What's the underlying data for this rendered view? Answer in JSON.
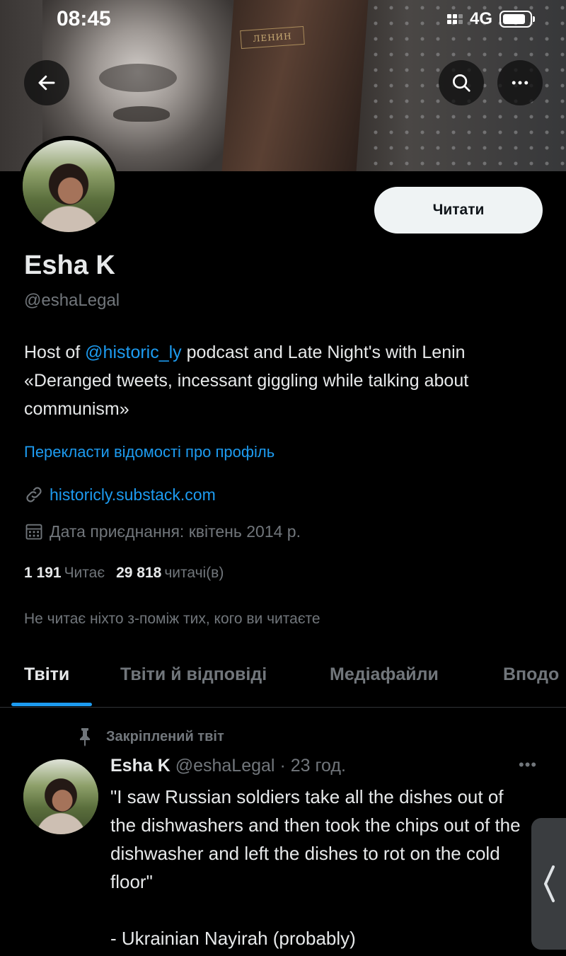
{
  "status_bar": {
    "time": "08:45",
    "network": "4G",
    "battery_level": 0.85
  },
  "banner": {
    "book_title": "ЛЕНИН"
  },
  "header": {
    "back_icon": "arrow-left-icon",
    "search_icon": "search-icon",
    "more_icon": "more-horizontal-icon"
  },
  "profile": {
    "follow_label": "Читати",
    "display_name": "Esha K",
    "handle": "@eshaLegal",
    "bio_prefix": "Host of ",
    "bio_mention": "@historic_ly",
    "bio_suffix": " podcast and Late Night's with Lenin «Deranged tweets, incessant giggling while talking about communism»",
    "translate_label": "Перекласти відомості про профіль",
    "website": "historicly.substack.com",
    "joined": "Дата приєднання: квітень 2014 р.",
    "following_count": "1 191",
    "following_label": "Читає",
    "followers_count": "29 818",
    "followers_label": "читачі(в)",
    "mutuals_note": "Не читає ніхто з-поміж тих, кого ви читаєте"
  },
  "tabs": [
    {
      "label": "Твіти",
      "active": true
    },
    {
      "label": "Твіти й відповіді",
      "active": false
    },
    {
      "label": "Медіафайли",
      "active": false
    },
    {
      "label": "Вподо",
      "active": false
    }
  ],
  "tweet": {
    "pinned_label": "Закріплений твіт",
    "author_name": "Esha K",
    "author_handle": "@eshaLegal",
    "time": "· 23 год.",
    "more": "•••",
    "text": "\"I saw Russian soldiers take all the dishes out of the dishwashers and then took the chips out of the dishwasher and left the dishes to rot on the cold floor\"\n\n- Ukrainian Nayirah (probably)"
  },
  "colors": {
    "accent": "#1d9bf0",
    "background": "#000000",
    "muted": "#71767b",
    "text": "#e7e9ea"
  }
}
